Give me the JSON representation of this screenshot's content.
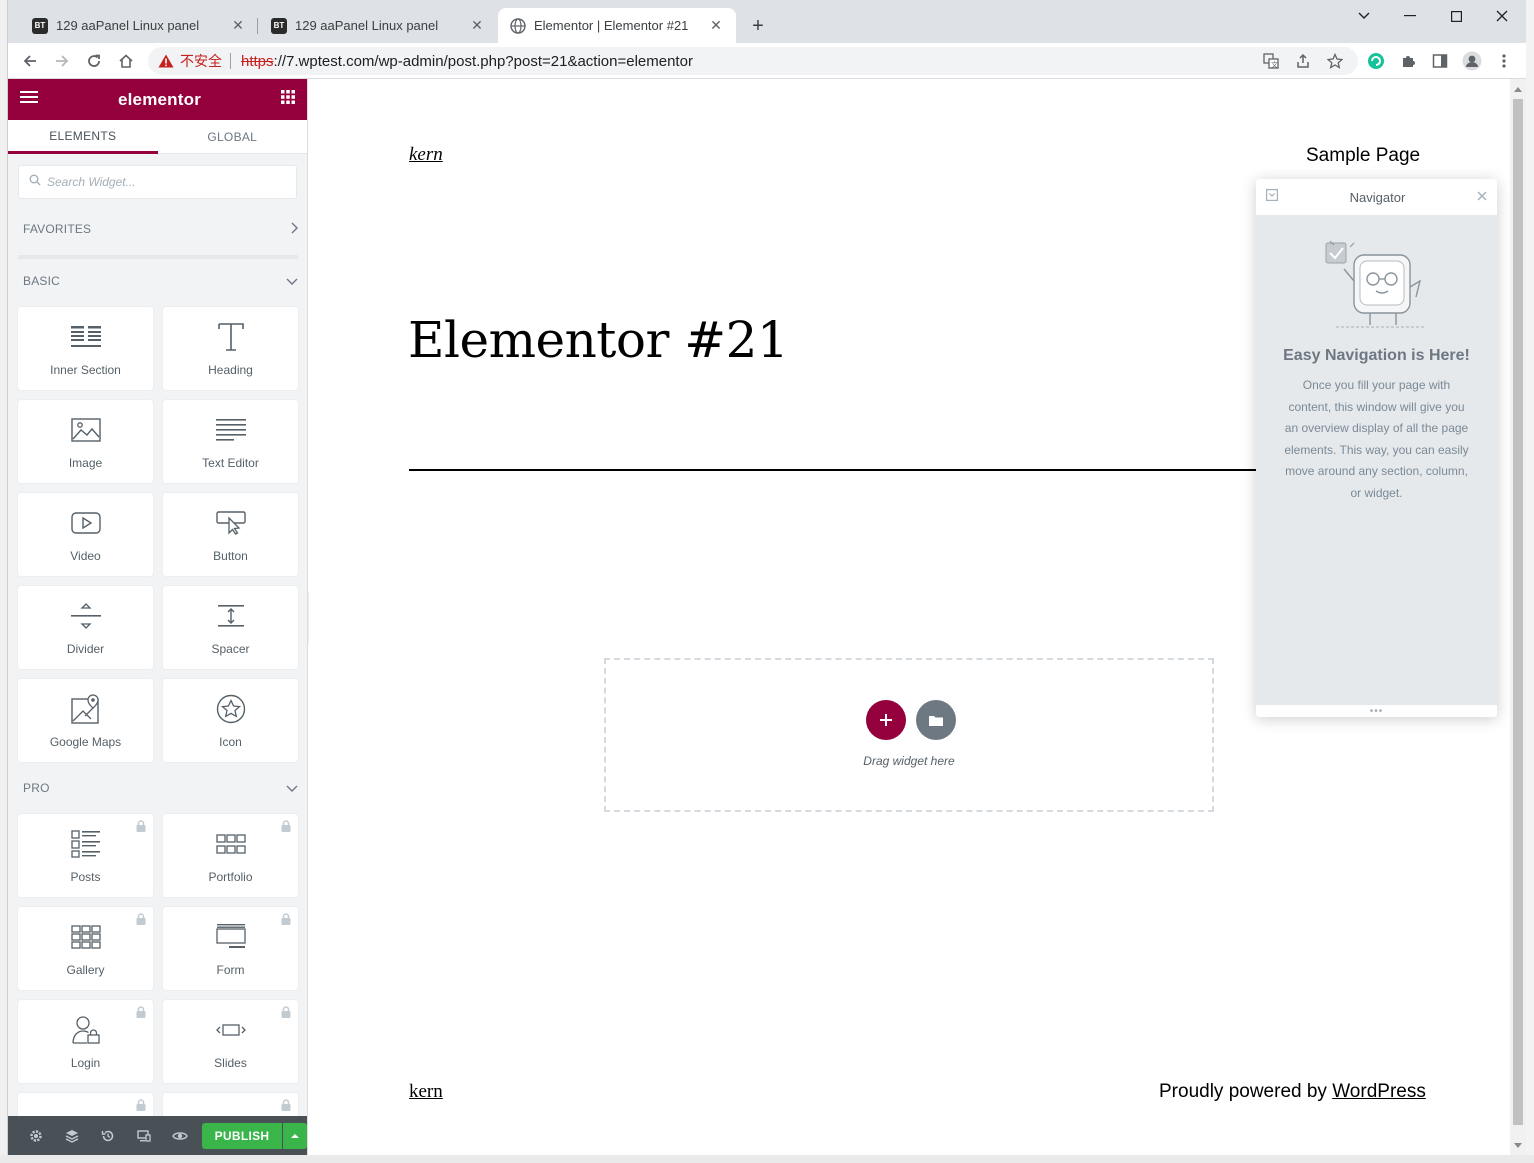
{
  "browser": {
    "tabs": [
      {
        "label": "129 aaPanel Linux panel",
        "favicon": "BT",
        "active": false
      },
      {
        "label": "129 aaPanel Linux panel",
        "favicon": "BT",
        "active": false
      },
      {
        "label": "Elementor | Elementor #21",
        "favicon": "globe-icon",
        "active": true
      }
    ],
    "security_label": "不安全",
    "url_scheme": "https",
    "url_rest": "://7.wptest.com/wp-admin/post.php?post=21&action=elementor"
  },
  "panel": {
    "logo": "elementor",
    "tabs": [
      {
        "label": "ELEMENTS",
        "active": true
      },
      {
        "label": "GLOBAL",
        "active": false
      }
    ],
    "search_placeholder": "Search Widget...",
    "categories": {
      "favorites": "FAVORITES",
      "basic": "BASIC",
      "pro": "PRO"
    },
    "basic_widgets": [
      {
        "label": "Inner Section",
        "icon": "inner-section-icon"
      },
      {
        "label": "Heading",
        "icon": "heading-icon"
      },
      {
        "label": "Image",
        "icon": "image-icon"
      },
      {
        "label": "Text Editor",
        "icon": "text-editor-icon"
      },
      {
        "label": "Video",
        "icon": "video-icon"
      },
      {
        "label": "Button",
        "icon": "button-icon"
      },
      {
        "label": "Divider",
        "icon": "divider-icon"
      },
      {
        "label": "Spacer",
        "icon": "spacer-icon"
      },
      {
        "label": "Google Maps",
        "icon": "google-maps-icon"
      },
      {
        "label": "Icon",
        "icon": "star-icon"
      }
    ],
    "pro_widgets": [
      {
        "label": "Posts",
        "icon": "posts-icon",
        "locked": true
      },
      {
        "label": "Portfolio",
        "icon": "portfolio-icon",
        "locked": true
      },
      {
        "label": "Gallery",
        "icon": "gallery-icon",
        "locked": true
      },
      {
        "label": "Form",
        "icon": "form-icon",
        "locked": true
      },
      {
        "label": "Login",
        "icon": "login-icon",
        "locked": true
      },
      {
        "label": "Slides",
        "icon": "slides-icon",
        "locked": true
      }
    ],
    "footer": {
      "publish_label": "PUBLISH"
    }
  },
  "preview": {
    "site_title": "kern",
    "nav_link": "Sample Page",
    "page_title": "Elementor #21",
    "drag_text": "Drag widget here",
    "footer_site_title": "kern",
    "footer_credit_prefix": "Proudly powered by ",
    "footer_credit_link": "WordPress"
  },
  "navigator": {
    "title": "Navigator",
    "empty_title": "Easy Navigation is Here!",
    "empty_text": "Once you fill your page with content, this window will give you an overview display of all the page elements. This way, you can easily move around any section, column, or widget."
  },
  "colors": {
    "brand": "#93003c",
    "publish": "#39b54a",
    "panel_bg": "#f1f3f5",
    "footer_bg": "#495157"
  }
}
